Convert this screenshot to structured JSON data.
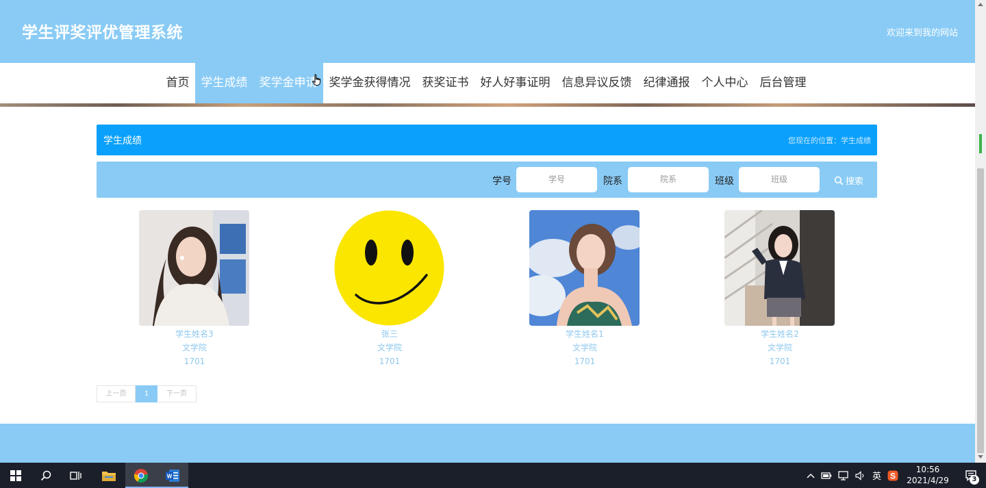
{
  "header": {
    "site_title": "学生评奖评优管理系统",
    "welcome": "欢迎来到我的网站"
  },
  "nav": {
    "items": [
      "首页",
      "学生成绩",
      "奖学金申请",
      "奖学金获得情况",
      "获奖证书",
      "好人好事证明",
      "信息异议反馈",
      "纪律通报",
      "个人中心",
      "后台管理"
    ],
    "active": [
      "学生成绩",
      "奖学金申请"
    ]
  },
  "breadcrumb": {
    "title": "学生成绩",
    "location": "您现在的位置：学生成绩"
  },
  "search": {
    "student_no_label": "学号",
    "student_no_placeholder": "学号",
    "dept_label": "院系",
    "dept_placeholder": "院系",
    "class_label": "班级",
    "class_placeholder": "班级",
    "button": "搜索"
  },
  "students": [
    {
      "name": "学生姓名3",
      "dept": "文学院",
      "class": "1701",
      "photo": "portrait-photo"
    },
    {
      "name": "张三",
      "dept": "文学院",
      "class": "1701",
      "photo": "smiley-face"
    },
    {
      "name": "学生姓名1",
      "dept": "文学院",
      "class": "1701",
      "photo": "portrait-photo"
    },
    {
      "name": "学生姓名2",
      "dept": "文学院",
      "class": "1701",
      "photo": "portrait-photo"
    }
  ],
  "pagination": {
    "prev": "上一页",
    "current": "1",
    "next": "下一页"
  },
  "taskbar": {
    "ime": "英",
    "time": "10:56",
    "date": "2021/4/29",
    "notifications": "3"
  },
  "colors": {
    "theme": "#89cbf5",
    "breadcrumb": "#0aa0fb",
    "card_text": "#8ec8ee"
  }
}
